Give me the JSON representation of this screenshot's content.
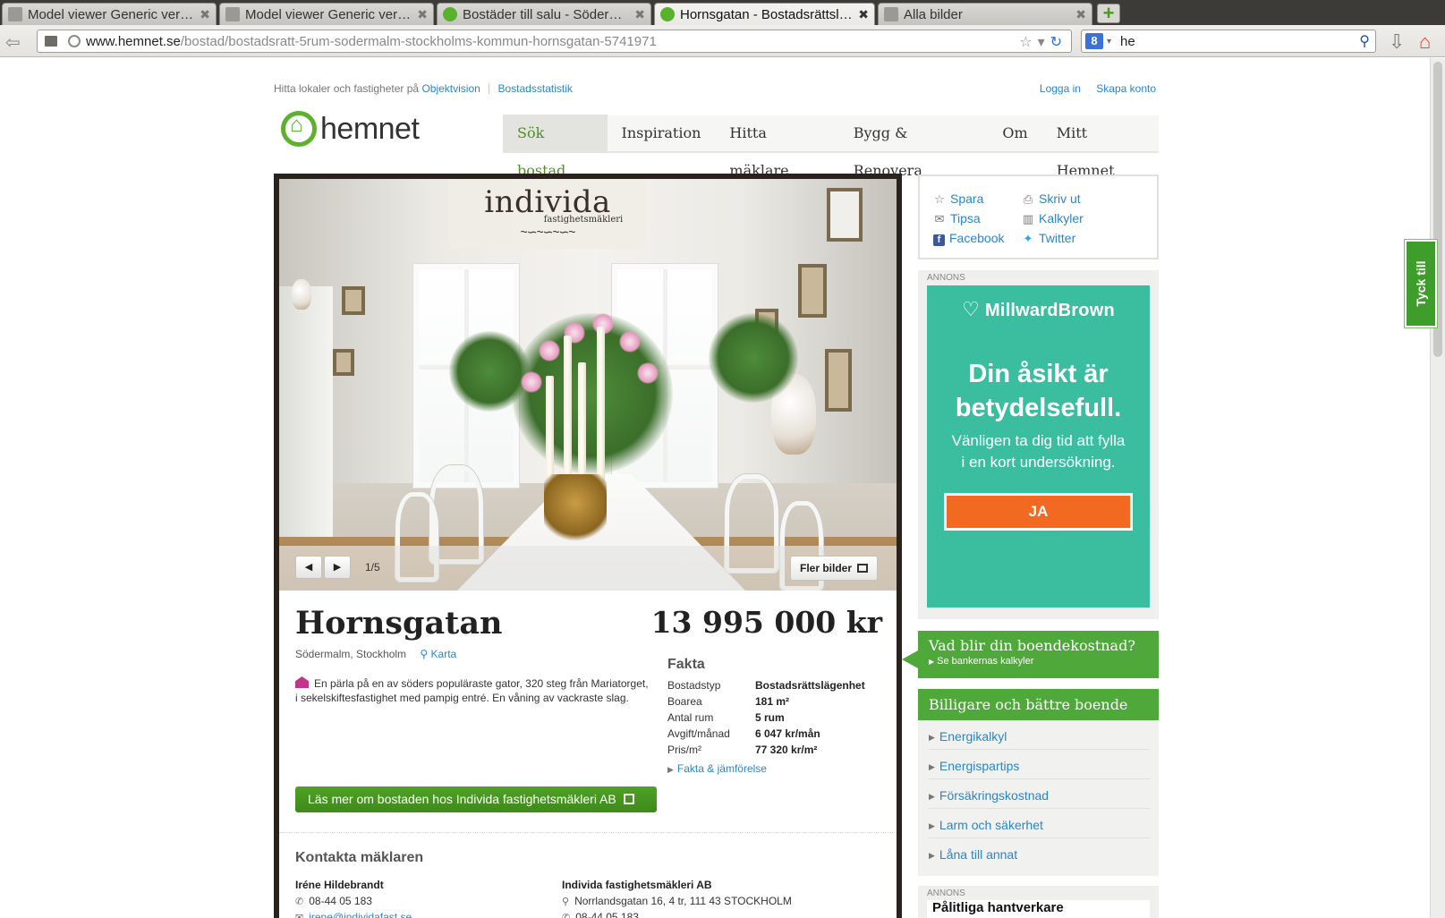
{
  "browser": {
    "tabs": [
      {
        "label": "Model viewer Generic version",
        "active": false
      },
      {
        "label": "Model viewer Generic version",
        "active": false
      },
      {
        "label": "Bostäder till salu - Söderma…",
        "active": false
      },
      {
        "label": "Hornsgatan - Bostadsrättsl…",
        "active": true
      },
      {
        "label": "Alla bilder",
        "active": false
      }
    ],
    "newtab_label": "+",
    "url_host": "www.hemnet.se",
    "url_path": "/bostad/bostadsratt-5rum-sodermalm-stockholms-kommun-hornsgatan-5741971",
    "search_value": "he",
    "search_engine_label": "8"
  },
  "header": {
    "topline_text": "Hitta lokaler och fastigheter på",
    "objektvision": "Objektvision",
    "bostadsstatistik": "Bostadsstatistik",
    "login": "Logga in",
    "signup": "Skapa konto",
    "logo_text": "hemnet",
    "nav": [
      {
        "label": "Sök bostad",
        "active": true
      },
      {
        "label": "Inspiration",
        "active": false
      },
      {
        "label": "Hitta mäklare",
        "active": false
      },
      {
        "label": "Bygg & Renovera",
        "active": false
      },
      {
        "label": "Om",
        "active": false
      },
      {
        "label": "Mitt Hemnet",
        "active": false
      }
    ]
  },
  "gallery": {
    "brand_name": "individa",
    "brand_sub": "fastighetsmäkleri",
    "counter": "1/5",
    "more_label": "Fler bilder"
  },
  "listing": {
    "title": "Hornsgatan",
    "location": "Södermalm, Stockholm",
    "map_link": "Karta",
    "description": "En pärla på en av söders populäraste gator, 320 steg från Mariatorget, i sekelskiftesfastighet med pampig entré. En våning av vackraste slag.",
    "price": "13 995 000 kr",
    "fakta_title": "Fakta",
    "fakta": [
      {
        "key": "Bostadstyp",
        "value": "Bostadsrättslägenhet"
      },
      {
        "key": "Boarea",
        "value": "181 m²"
      },
      {
        "key": "Antal rum",
        "value": "5 rum"
      },
      {
        "key": "Avgift/månad",
        "value": "6 047 kr/mån"
      },
      {
        "key": "Pris/m²",
        "value": "77 320 kr/m²"
      }
    ],
    "fakta_link": "Fakta & jämförelse",
    "cta": "Läs mer om bostaden hos Individa fastighetsmäkleri AB"
  },
  "contact": {
    "title": "Kontakta mäklaren",
    "agent_name": "Iréne Hildebrandt",
    "agent_phone": "08-44 05 183",
    "agent_email": "irene@individafast.se",
    "firm_name": "Individa fastighetsmäkleri AB",
    "firm_address": "Norrlandsgatan 16, 4 tr, 111 43 STOCKHOLM",
    "firm_phone": "08-44 05 183"
  },
  "share": {
    "save": "Spara",
    "tip": "Tipsa",
    "facebook": "Facebook",
    "print": "Skriv ut",
    "calc": "Kalkyler",
    "twitter": "Twitter"
  },
  "ad": {
    "label": "ANNONS",
    "brand": "MillwardBrown",
    "headline_1": "Din åsikt är",
    "headline_2": "betydelsefull.",
    "body_1": "Vänligen ta dig tid att fylla",
    "body_2": "i en kort undersökning.",
    "button": "JA"
  },
  "cost": {
    "title": "Vad blir din boendekostnad?",
    "sub": "Se bankernas kalkyler"
  },
  "better": {
    "title": "Billigare och bättre boende",
    "items": [
      "Energikalkyl",
      "Energispartips",
      "Försäkringskostnad",
      "Larm och säkerhet",
      "Låna till annat"
    ]
  },
  "ad2": {
    "label": "ANNONS",
    "title": "Pålitliga hantverkare"
  },
  "feedback": "Tyck till"
}
